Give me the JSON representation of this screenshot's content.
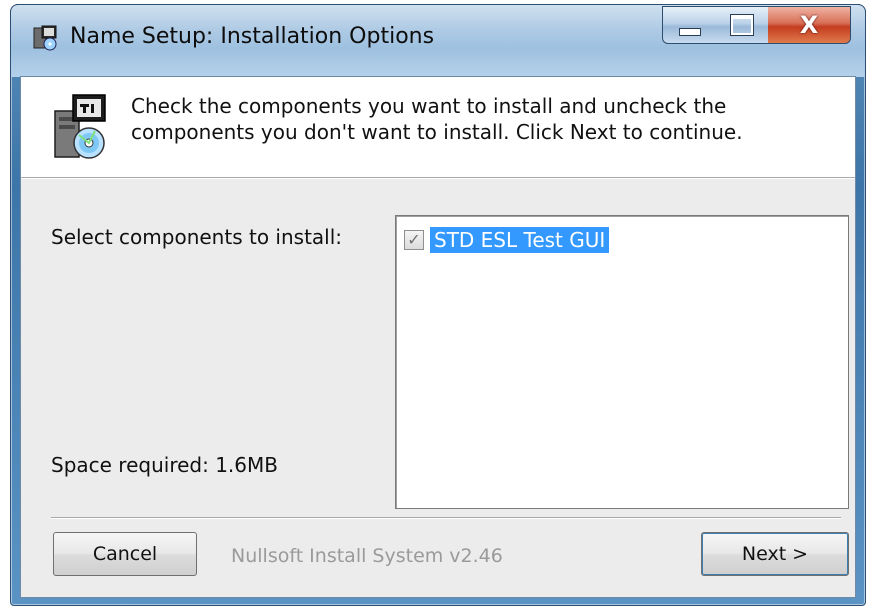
{
  "window": {
    "title": "Name Setup: Installation Options",
    "controls": {
      "minimize_icon": "minimize-icon",
      "maximize_icon": "maximize-icon",
      "close_icon": "close-icon",
      "close_glyph": "X"
    }
  },
  "header": {
    "description": "Check the components you want to install and uncheck the components you don't want to install. Click Next to continue.",
    "icon": "installer-icon"
  },
  "components": {
    "select_label": "Select components to install:",
    "items": [
      {
        "label": "STD ESL Test GUI",
        "checked": true,
        "selected": true
      }
    ],
    "space_required": "Space required: 1.6MB"
  },
  "footer": {
    "branding": "Nullsoft Install System v2.46",
    "cancel_label": "Cancel",
    "next_label": "Next >"
  },
  "colors": {
    "selection": "#3399ff",
    "close_button": "#c43d20"
  }
}
